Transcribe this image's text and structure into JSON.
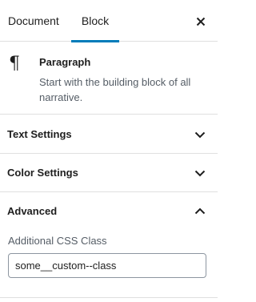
{
  "tabs": {
    "document": "Document",
    "block": "Block",
    "active": "block",
    "close_icon": "close-icon"
  },
  "block_card": {
    "icon": "paragraph-icon",
    "icon_glyph": "¶",
    "title": "Paragraph",
    "description": "Start with the building block of all narrative."
  },
  "panels": {
    "text_settings": {
      "label": "Text Settings",
      "expanded": false
    },
    "color_settings": {
      "label": "Color Settings",
      "expanded": false
    },
    "advanced": {
      "label": "Advanced",
      "expanded": true,
      "css_class_label": "Additional CSS Class",
      "css_class_value": "some__custom--class"
    }
  },
  "colors": {
    "accent": "#007cba",
    "text": "#1e1e1e",
    "muted": "#555d66",
    "divider": "#e0e0e0"
  }
}
